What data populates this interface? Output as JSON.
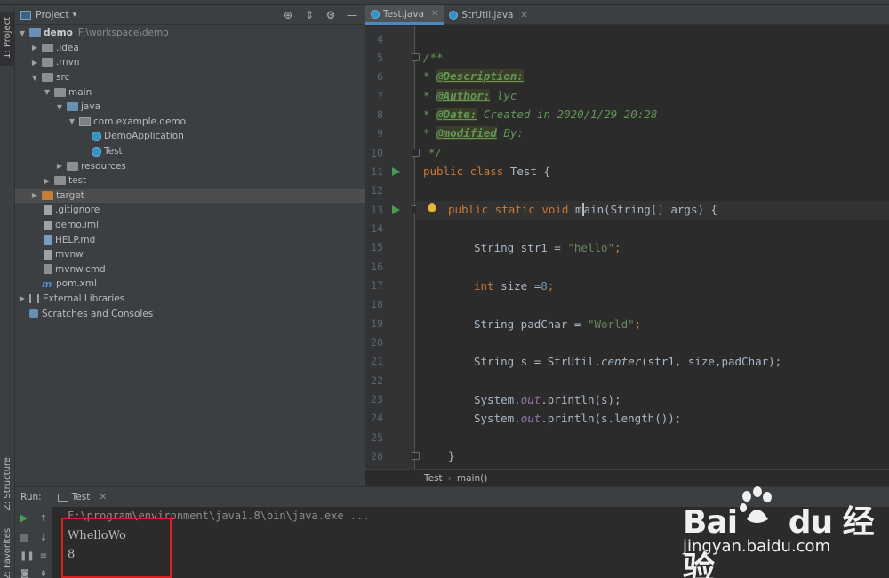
{
  "left_strip": {
    "project_tab": "1: Project",
    "structure_tab": "Z: Structure",
    "favorites_tab": "2: Favorites"
  },
  "project_panel": {
    "title": "Project",
    "tree": [
      {
        "label": "demo",
        "path": "F:\\workspace\\demo"
      },
      {
        "label": ".idea"
      },
      {
        "label": ".mvn"
      },
      {
        "label": "src"
      },
      {
        "label": "main"
      },
      {
        "label": "java"
      },
      {
        "label": "com.example.demo"
      },
      {
        "label": "DemoApplication"
      },
      {
        "label": "Test"
      },
      {
        "label": "resources"
      },
      {
        "label": "test"
      },
      {
        "label": "target"
      },
      {
        "label": ".gitignore"
      },
      {
        "label": "demo.iml"
      },
      {
        "label": "HELP.md"
      },
      {
        "label": "mvnw"
      },
      {
        "label": "mvnw.cmd"
      },
      {
        "label": "pom.xml"
      },
      {
        "label": "External Libraries"
      },
      {
        "label": "Scratches and Consoles"
      }
    ]
  },
  "editor": {
    "tabs": [
      {
        "label": "Test.java"
      },
      {
        "label": "StrUtil.java"
      }
    ],
    "line_numbers": [
      "4",
      "5",
      "6",
      "7",
      "8",
      "9",
      "10",
      "11",
      "12",
      "13",
      "14",
      "15",
      "16",
      "17",
      "18",
      "19",
      "20",
      "21",
      "22",
      "23",
      "24",
      "25",
      "26"
    ],
    "code": {
      "l5": "/**",
      "l6_tag": "@Description:",
      "l7_tag": "@Author:",
      "l7_val": " lyc",
      "l8_tag": "@Date:",
      "l8_val": " Created in 2020/1/29 20:28",
      "l9_tag": "@modified",
      "l9_val": " By:",
      "l10": "*/",
      "l11_kw": "public class",
      "l11_rest": " Test {",
      "l13_kw": "public static void",
      "l13_m1": "m",
      "l13_m2": "ain",
      "l13_rest": "(String[] args) {",
      "l15_a": "String str1 = ",
      "l15_str": "\"hello\"",
      "l17_kw": "int",
      "l17_a": " size =",
      "l17_num": "8",
      "l19_a": "String padChar = ",
      "l19_str": "\"World\"",
      "l21_a": "String s = StrUtil.",
      "l21_m": "center",
      "l21_b": "(str1, size,padChar);",
      "l23_a": "System.",
      "l23_f": "out",
      "l23_b": ".println(s);",
      "l24_a": "System.",
      "l24_f": "out",
      "l24_b": ".println(s.length());",
      "l26": "}",
      "semicolon": ";",
      "comment_star": "* "
    },
    "breadcrumb": [
      "Test",
      "main()"
    ]
  },
  "run_panel": {
    "label": "Run:",
    "tab": "Test",
    "console_lines": [
      "F:\\program\\environment\\java1.8\\bin\\java.exe ...",
      "WhelloWo",
      "8"
    ]
  },
  "watermark": {
    "logo": "Bai du 经验",
    "url": "jingyan.baidu.com"
  },
  "colors": {
    "highlight_box": "#e02020",
    "accent": "#4a88c7",
    "run_green": "#499c54"
  }
}
